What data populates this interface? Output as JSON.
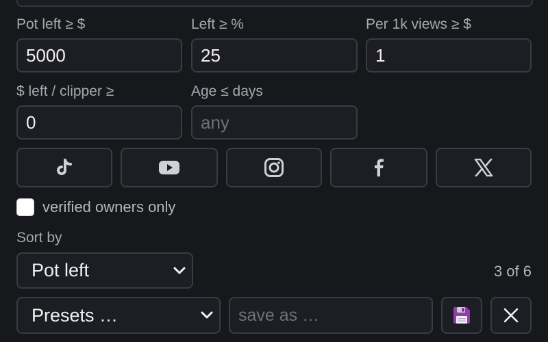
{
  "filters": {
    "pot_left": {
      "label": "Pot left ≥ $",
      "value": "5000"
    },
    "left_pct": {
      "label": "Left ≥ %",
      "value": "25"
    },
    "per_1k_views": {
      "label": "Per 1k views ≥ $",
      "value": "1"
    },
    "left_per_clipper": {
      "label": "$ left / clipper ≥",
      "value": "0"
    },
    "age_days": {
      "label": "Age ≤ days",
      "value": "",
      "placeholder": "any"
    }
  },
  "platforms": [
    {
      "name": "tiktok",
      "icon": "tiktok-icon"
    },
    {
      "name": "youtube",
      "icon": "youtube-icon"
    },
    {
      "name": "instagram",
      "icon": "instagram-icon"
    },
    {
      "name": "facebook",
      "icon": "facebook-icon"
    },
    {
      "name": "x",
      "icon": "x-icon"
    }
  ],
  "verified": {
    "label": "verified owners only",
    "checked": false
  },
  "sort": {
    "label": "Sort by",
    "selected": "Pot left",
    "count": "3 of 6"
  },
  "presets": {
    "selected": "Presets …",
    "save_placeholder": "save as …",
    "save_icon": "floppy-disk-icon",
    "clear_icon": "close-icon"
  }
}
